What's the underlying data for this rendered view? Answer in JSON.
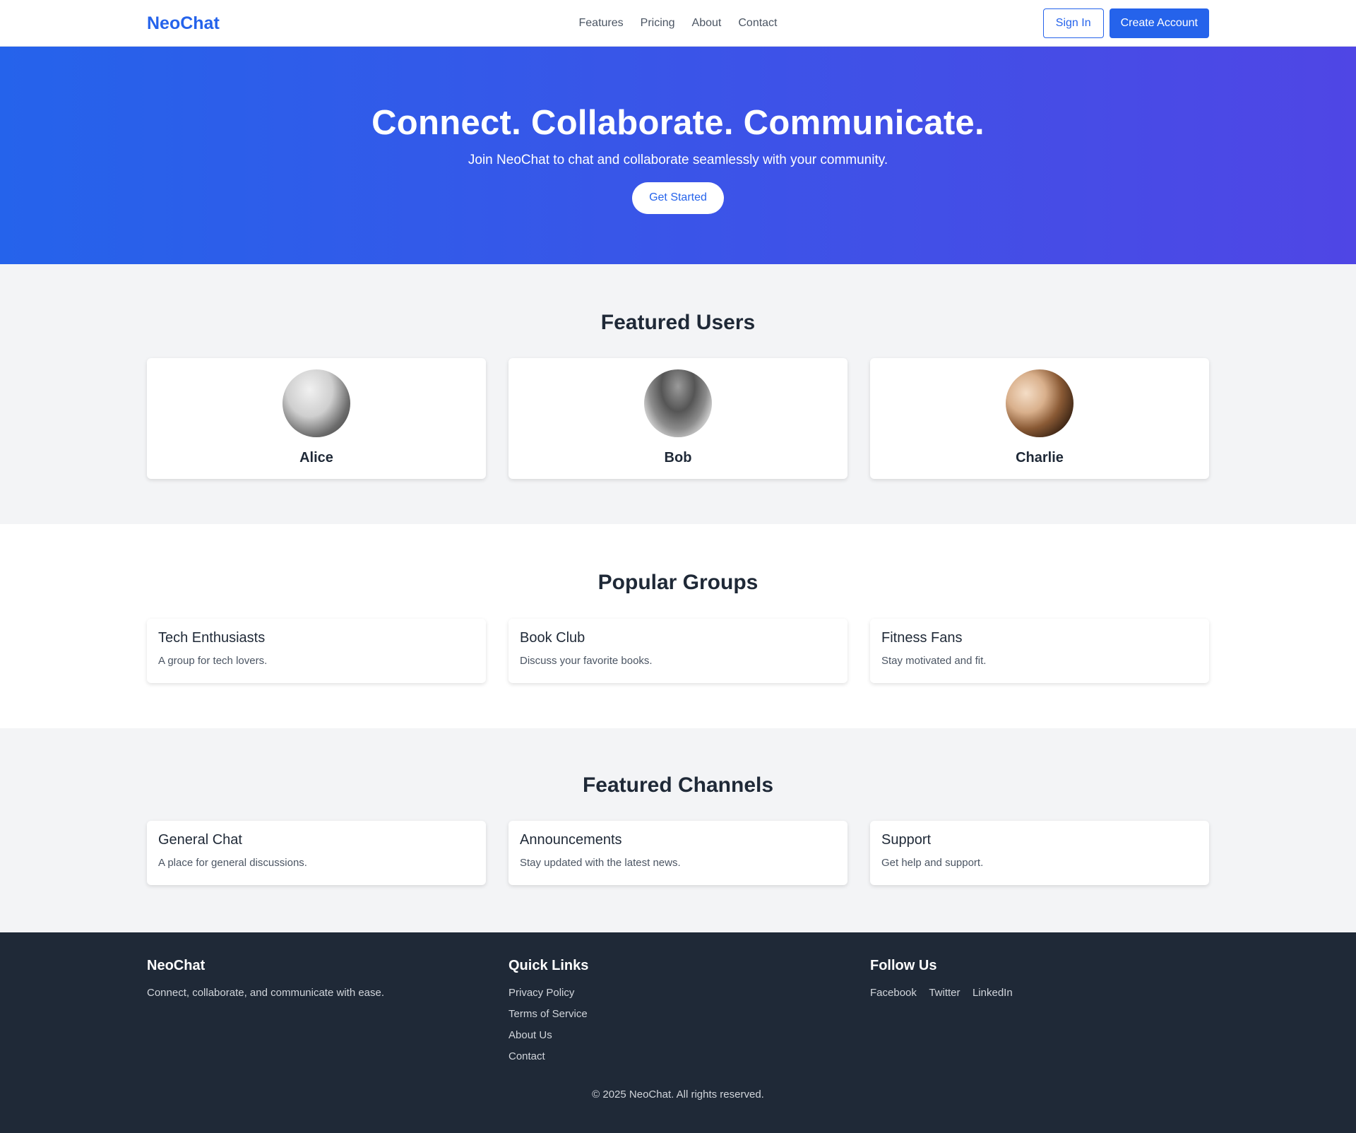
{
  "nav": {
    "brand": "NeoChat",
    "links": [
      "Features",
      "Pricing",
      "About",
      "Contact"
    ],
    "sign_in": "Sign In",
    "create_account": "Create Account"
  },
  "hero": {
    "title": "Connect. Collaborate. Communicate.",
    "subtitle": "Join NeoChat to chat and collaborate seamlessly with your community.",
    "cta": "Get Started"
  },
  "featured_users": {
    "title": "Featured Users",
    "users": [
      {
        "name": "Alice"
      },
      {
        "name": "Bob"
      },
      {
        "name": "Charlie"
      }
    ]
  },
  "popular_groups": {
    "title": "Popular Groups",
    "groups": [
      {
        "name": "Tech Enthusiasts",
        "description": "A group for tech lovers."
      },
      {
        "name": "Book Club",
        "description": "Discuss your favorite books."
      },
      {
        "name": "Fitness Fans",
        "description": "Stay motivated and fit."
      }
    ]
  },
  "featured_channels": {
    "title": "Featured Channels",
    "channels": [
      {
        "name": "General Chat",
        "description": "A place for general discussions."
      },
      {
        "name": "Announcements",
        "description": "Stay updated with the latest news."
      },
      {
        "name": "Support",
        "description": "Get help and support."
      }
    ]
  },
  "footer": {
    "brand": "NeoChat",
    "tagline": "Connect, collaborate, and communicate with ease.",
    "quick_links_title": "Quick Links",
    "quick_links": [
      "Privacy Policy",
      "Terms of Service",
      "About Us",
      "Contact"
    ],
    "follow_title": "Follow Us",
    "social": [
      "Facebook",
      "Twitter",
      "LinkedIn"
    ],
    "copyright": "© 2025 NeoChat. All rights reserved."
  },
  "colors": {
    "primary": "#2563eb",
    "hero_gradient_end": "#4f46e5",
    "footer_bg": "#1f2937",
    "section_gray": "#f3f4f6"
  }
}
